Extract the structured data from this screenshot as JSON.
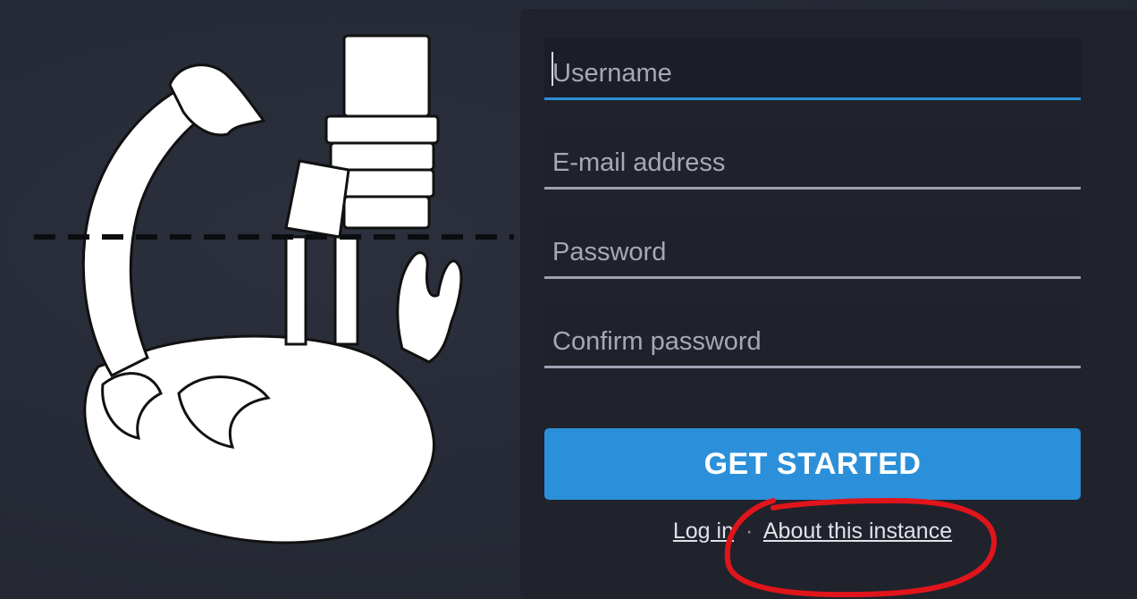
{
  "signup_form": {
    "username_placeholder": "Username",
    "email_placeholder": "E-mail address",
    "password_placeholder": "Password",
    "confirm_password_placeholder": "Confirm password",
    "submit_label": "GET STARTED"
  },
  "footer_links": {
    "login_label": "Log in",
    "separator": "·",
    "about_label": "About this instance"
  },
  "colors": {
    "accent": "#2b90d9",
    "background": "#262a36",
    "annotation": "#e0151b"
  }
}
